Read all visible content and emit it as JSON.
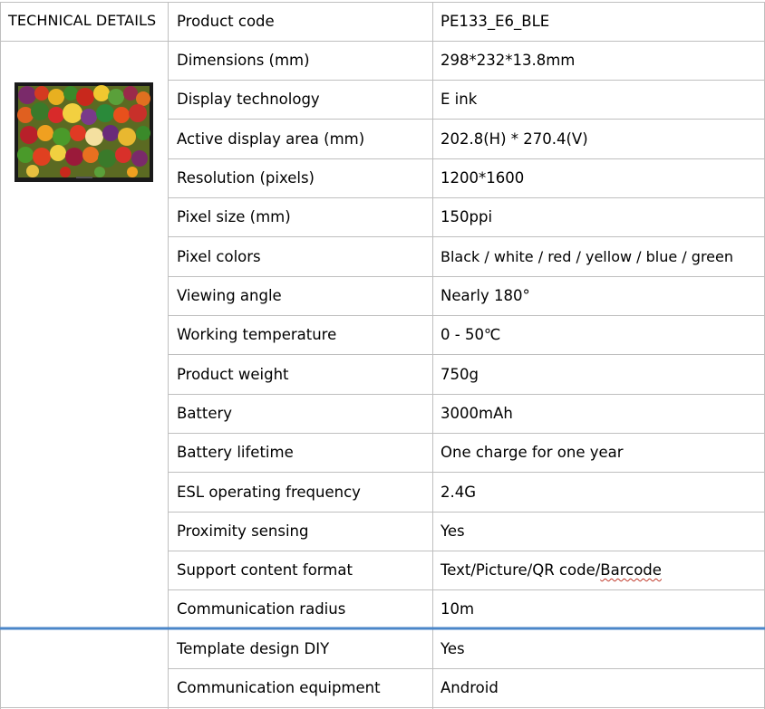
{
  "header_label": "TECHNICAL DETAILS",
  "image": {
    "description_icon": "product-photo-vegetables"
  },
  "accent_color": "#4a86c8",
  "rows": [
    {
      "label": "Product code",
      "value": "PE133_E6_BLE"
    },
    {
      "label": "Dimensions (mm)",
      "value": "298*232*13.8mm"
    },
    {
      "label": "Display technology",
      "value": "E ink"
    },
    {
      "label": "Active display area (mm)",
      "value": "202.8(H) * 270.4(V)"
    },
    {
      "label": "Resolution (pixels)",
      "value": "1200*1600"
    },
    {
      "label": "Pixel size (mm)",
      "value": "150ppi"
    },
    {
      "label": "Pixel colors",
      "value": "Black / white / red / yellow / blue / green"
    },
    {
      "label": "Viewing angle",
      "value": "Nearly 180°"
    },
    {
      "label": "Working temperature",
      "value": "0 - 50℃"
    },
    {
      "label": "Product weight",
      "value": "750g"
    },
    {
      "label": "Battery",
      "value": "3000mAh"
    },
    {
      "label": "Battery lifetime",
      "value": "One charge for one year"
    },
    {
      "label": "ESL operating frequency",
      "value": "2.4G"
    },
    {
      "label": "Proximity sensing",
      "value": "Yes"
    },
    {
      "label": "Support content format",
      "value_prefix": "Text/Picture/QR code/",
      "value_marked": "Barcode"
    },
    {
      "label": "Communication radius",
      "value": "10m"
    },
    {
      "label": "Template design DIY",
      "value": "Yes"
    },
    {
      "label": "Communication equipment",
      "value": "Android"
    }
  ]
}
